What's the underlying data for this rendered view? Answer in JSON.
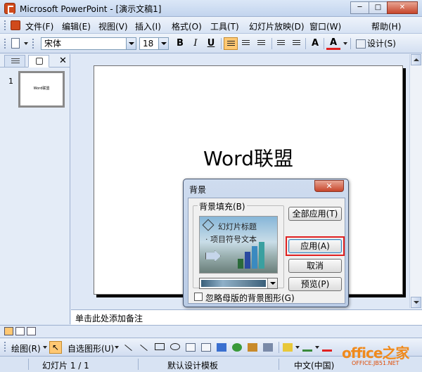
{
  "window": {
    "title": "Microsoft PowerPoint - [演示文稿1]",
    "minimize_glyph": "─",
    "maximize_glyph": "□",
    "close_glyph": "✕"
  },
  "menu": {
    "items": [
      "文件(F)",
      "编辑(E)",
      "视图(V)",
      "插入(I)",
      "格式(O)",
      "工具(T)",
      "幻灯片放映(D)",
      "窗口(W)",
      "帮助(H)"
    ]
  },
  "format_toolbar": {
    "font_name": "宋体",
    "font_size": "18",
    "bold": "B",
    "italic": "I",
    "underline": "U",
    "increase_font": "A",
    "font_color": "A",
    "design": "设计(S)"
  },
  "left_pane": {
    "close_glyph": "✕",
    "slide_number": "1",
    "thumb_title": "Word联盟"
  },
  "slide": {
    "title": "Word联盟"
  },
  "notes": {
    "placeholder": "单击此处添加备注"
  },
  "drawing_toolbar": {
    "draw_label": "绘图(R)",
    "autoshapes_label": "自选图形(U)",
    "cursor_glyph": "↖"
  },
  "status_bar": {
    "slide_info": "幻灯片 1 / 1",
    "template": "默认设计模板",
    "language": "中文(中国)"
  },
  "dialog": {
    "title": "背景",
    "close_glyph": "✕",
    "fill_group_label": "背景填充(B)",
    "preview_title": "幻灯片标题",
    "preview_body": "· 项目符号文本",
    "apply_all": "全部应用(T)",
    "apply": "应用(A)",
    "cancel": "取消",
    "preview": "预览(P)",
    "ignore_master": "忽略母版的背景图形(G)"
  },
  "watermark": {
    "main": "office之家",
    "sub": "OFFICE.JB51.NET"
  },
  "colors": {
    "accent_highlight": "#ffc873",
    "apply_outline": "#e02020",
    "font_color_bar": "#e02020"
  }
}
